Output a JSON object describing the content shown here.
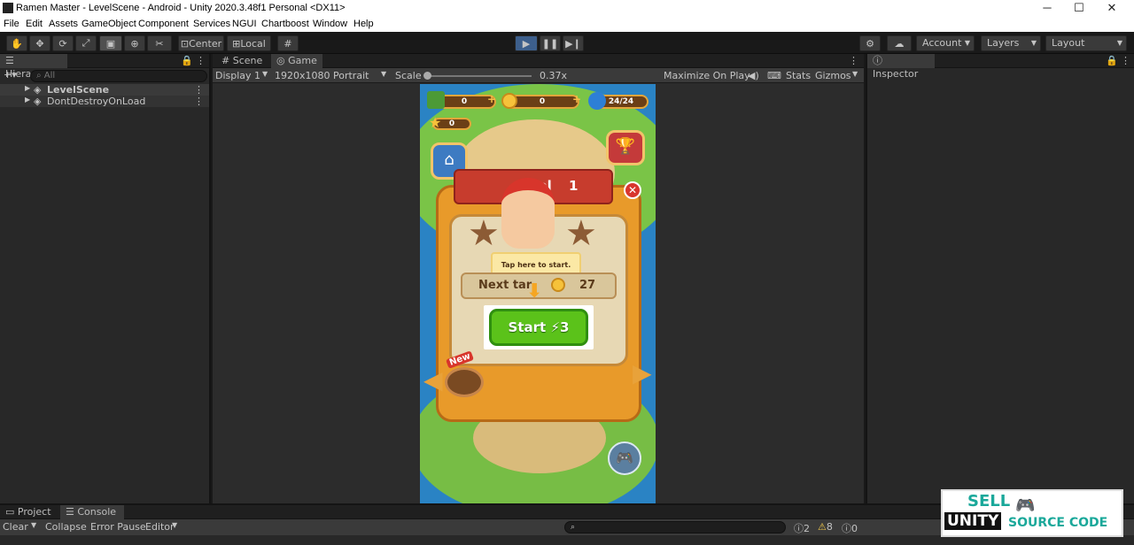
{
  "window": {
    "title": "Ramen Master - LevelScene - Android - Unity 2020.3.48f1 Personal <DX11>"
  },
  "menu": [
    "File",
    "Edit",
    "Assets",
    "GameObject",
    "Component",
    "Services",
    "NGUI",
    "Chartboost",
    "Window",
    "Help"
  ],
  "toolbar": {
    "center": "Center",
    "local": "Local",
    "account": "Account",
    "layers": "Layers",
    "layout": "Layout"
  },
  "hierarchy": {
    "tab": "Hierarchy",
    "search_placeholder": "All",
    "items": [
      "LevelScene",
      "DontDestroyOnLoad"
    ]
  },
  "scene_tabs": {
    "scene": "Scene",
    "game": "Game"
  },
  "gamebar": {
    "display": "Display 1",
    "resolution": "1920x1080 Portrait",
    "scale_label": "Scale",
    "scale_value": "0.37x",
    "maximize": "Maximize On Play",
    "stats": "Stats",
    "gizmos": "Gizmos"
  },
  "game": {
    "hud": {
      "cash": "0",
      "coins": "0",
      "energy": "24/24",
      "stars": "0"
    },
    "popup": {
      "level_text": "rel",
      "level_num": "1",
      "tooltip": "Tap here to start.",
      "target_label": "Next tar",
      "target_value": "27",
      "start_label": "Start",
      "start_cost": "3",
      "new_badge": "New"
    }
  },
  "inspector": {
    "tab": "Inspector"
  },
  "bottom": {
    "tabs": [
      "Project",
      "Console"
    ],
    "buttons": [
      "Clear",
      "Collapse",
      "Error Pause",
      "Editor"
    ],
    "counts": {
      "info": "2",
      "warn": "8",
      "error": "0"
    }
  },
  "watermark": {
    "line1": "SELL",
    "line2": "UNITY",
    "line3": "SOURCE CODE"
  }
}
